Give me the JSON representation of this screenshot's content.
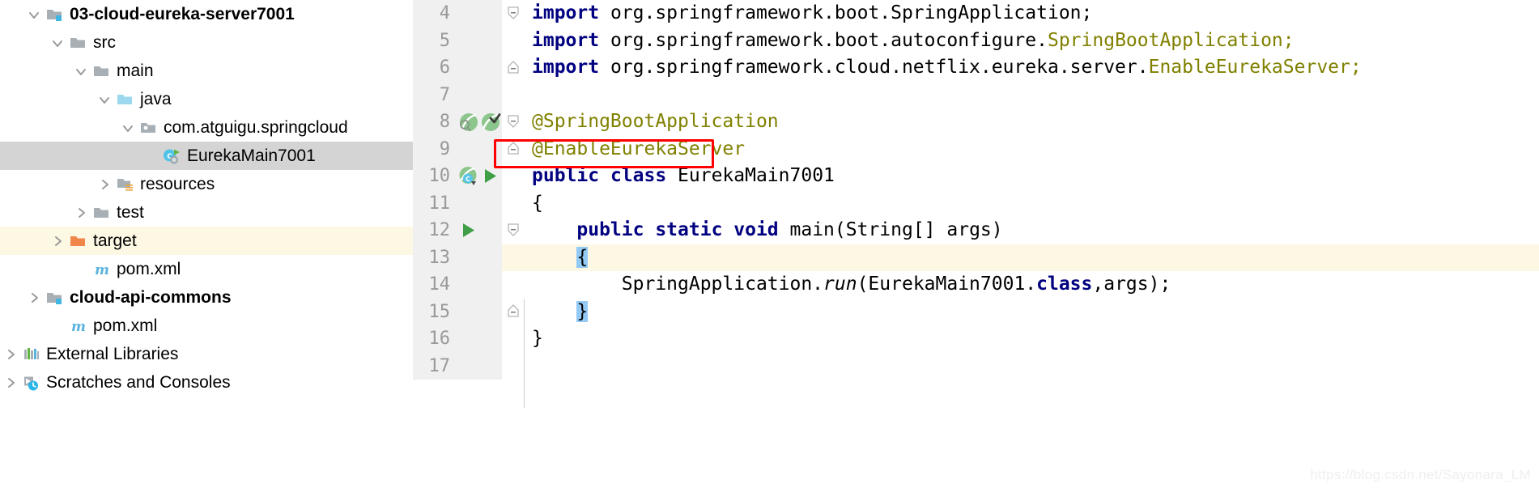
{
  "project_tree": {
    "items": [
      {
        "label": "03-cloud-eureka-server7001",
        "icon": "module-folder-icon",
        "indent": 1,
        "arrow": "expanded",
        "bold": true,
        "state": "normal"
      },
      {
        "label": "src",
        "icon": "folder-icon",
        "indent": 2,
        "arrow": "expanded",
        "bold": false,
        "state": "normal"
      },
      {
        "label": "main",
        "icon": "folder-icon",
        "indent": 3,
        "arrow": "expanded",
        "bold": false,
        "state": "normal"
      },
      {
        "label": "java",
        "icon": "source-folder-icon",
        "indent": 4,
        "arrow": "expanded",
        "bold": false,
        "state": "normal"
      },
      {
        "label": "com.atguigu.springcloud",
        "icon": "package-icon",
        "indent": 5,
        "arrow": "expanded",
        "bold": false,
        "state": "normal"
      },
      {
        "label": "EurekaMain7001",
        "icon": "java-class-run-icon",
        "indent": 6,
        "arrow": "none",
        "bold": false,
        "state": "selected"
      },
      {
        "label": "resources",
        "icon": "resources-folder-icon",
        "indent": 4,
        "arrow": "collapsed",
        "bold": false,
        "state": "normal"
      },
      {
        "label": "test",
        "icon": "folder-icon",
        "indent": 3,
        "arrow": "collapsed",
        "bold": false,
        "state": "normal"
      },
      {
        "label": "target",
        "icon": "target-folder-icon",
        "indent": 2,
        "arrow": "collapsed",
        "bold": false,
        "state": "highlight"
      },
      {
        "label": "pom.xml",
        "icon": "maven-icon",
        "indent": 3,
        "arrow": "none",
        "bold": false,
        "state": "normal"
      },
      {
        "label": "cloud-api-commons",
        "icon": "module-folder-icon",
        "indent": 1,
        "arrow": "collapsed",
        "bold": true,
        "state": "normal"
      },
      {
        "label": "pom.xml",
        "icon": "maven-icon",
        "indent": 2,
        "arrow": "none",
        "bold": false,
        "state": "normal"
      },
      {
        "label": "External Libraries",
        "icon": "libraries-icon",
        "indent": 0,
        "arrow": "collapsed",
        "bold": false,
        "state": "normal"
      },
      {
        "label": "Scratches and Consoles",
        "icon": "scratches-icon",
        "indent": 0,
        "arrow": "collapsed",
        "bold": false,
        "state": "normal"
      }
    ]
  },
  "editor": {
    "watermark": "https://blog.csdn.net/Sayonara_LM",
    "lines": [
      {
        "number": "4",
        "fold": "fold-start",
        "gutter_icons": [],
        "current": false,
        "tokens": [
          {
            "t": "import ",
            "c": "kw"
          },
          {
            "t": "org.springframework.boot.SpringApplication;",
            "c": "plain"
          }
        ]
      },
      {
        "number": "5",
        "fold": "none",
        "gutter_icons": [],
        "current": false,
        "tokens": [
          {
            "t": "import ",
            "c": "kw"
          },
          {
            "t": "org.springframework.boot.autoconfigure.",
            "c": "plain"
          },
          {
            "t": "SpringBootApplication;",
            "c": "anno"
          }
        ]
      },
      {
        "number": "6",
        "fold": "fold-end",
        "gutter_icons": [],
        "current": false,
        "tokens": [
          {
            "t": "import ",
            "c": "kw"
          },
          {
            "t": "org.springframework.cloud.netflix.eureka.server.",
            "c": "plain"
          },
          {
            "t": "EnableEurekaServer;",
            "c": "anno"
          }
        ]
      },
      {
        "number": "7",
        "fold": "none",
        "gutter_icons": [],
        "current": false,
        "tokens": []
      },
      {
        "number": "8",
        "fold": "fold-start",
        "gutter_icons": [
          "spring-bean-search-icon",
          "spring-bean-check-icon"
        ],
        "current": false,
        "tokens": [
          {
            "t": "@SpringBootApplication",
            "c": "anno"
          }
        ]
      },
      {
        "number": "9",
        "fold": "fold-end",
        "gutter_icons": [],
        "current": false,
        "tokens": [
          {
            "t": "@EnableEurekaServer",
            "c": "anno"
          }
        ]
      },
      {
        "number": "10",
        "fold": "none",
        "gutter_icons": [
          "spring-bean-class-icon",
          "run-triangle-icon"
        ],
        "current": false,
        "tokens": [
          {
            "t": "public ",
            "c": "kw"
          },
          {
            "t": "class ",
            "c": "kw"
          },
          {
            "t": "EurekaMain7001",
            "c": "plain"
          }
        ]
      },
      {
        "number": "11",
        "fold": "none",
        "gutter_icons": [],
        "current": false,
        "tokens": [
          {
            "t": "{",
            "c": "plain"
          }
        ]
      },
      {
        "number": "12",
        "fold": "fold-start",
        "gutter_icons": [
          "run-triangle-icon"
        ],
        "current": false,
        "tokens": [
          {
            "t": "    ",
            "c": "plain"
          },
          {
            "t": "public ",
            "c": "kw"
          },
          {
            "t": "static ",
            "c": "kw"
          },
          {
            "t": "void ",
            "c": "kw"
          },
          {
            "t": "main(String[] args)",
            "c": "plain"
          }
        ]
      },
      {
        "number": "13",
        "fold": "none",
        "gutter_icons": [],
        "current": true,
        "tokens": [
          {
            "t": "    ",
            "c": "plain"
          },
          {
            "t": "{",
            "c": "brace-hl"
          }
        ]
      },
      {
        "number": "14",
        "fold": "none",
        "gutter_icons": [],
        "current": false,
        "tokens": [
          {
            "t": "        SpringApplication.",
            "c": "plain"
          },
          {
            "t": "run",
            "c": "ital"
          },
          {
            "t": "(EurekaMain7001.",
            "c": "plain"
          },
          {
            "t": "class",
            "c": "kw"
          },
          {
            "t": ",args);",
            "c": "plain"
          }
        ]
      },
      {
        "number": "15",
        "fold": "fold-end",
        "gutter_icons": [],
        "current": false,
        "tokens": [
          {
            "t": "    ",
            "c": "plain"
          },
          {
            "t": "}",
            "c": "brace-hl"
          }
        ]
      },
      {
        "number": "16",
        "fold": "none",
        "gutter_icons": [],
        "current": false,
        "tokens": [
          {
            "t": "}",
            "c": "plain"
          }
        ]
      },
      {
        "number": "17",
        "fold": "none",
        "gutter_icons": [],
        "current": false,
        "tokens": []
      }
    ]
  },
  "colors": {
    "selection_gray": "#d4d4d4",
    "current_line_yellow": "#fdf8e3",
    "annotation_olive": "#808000",
    "keyword_navy": "#000080",
    "highlight_red": "#ff0000",
    "brace_match_blue": "#93c9f5",
    "gutter_gray": "#f0f0f0"
  }
}
